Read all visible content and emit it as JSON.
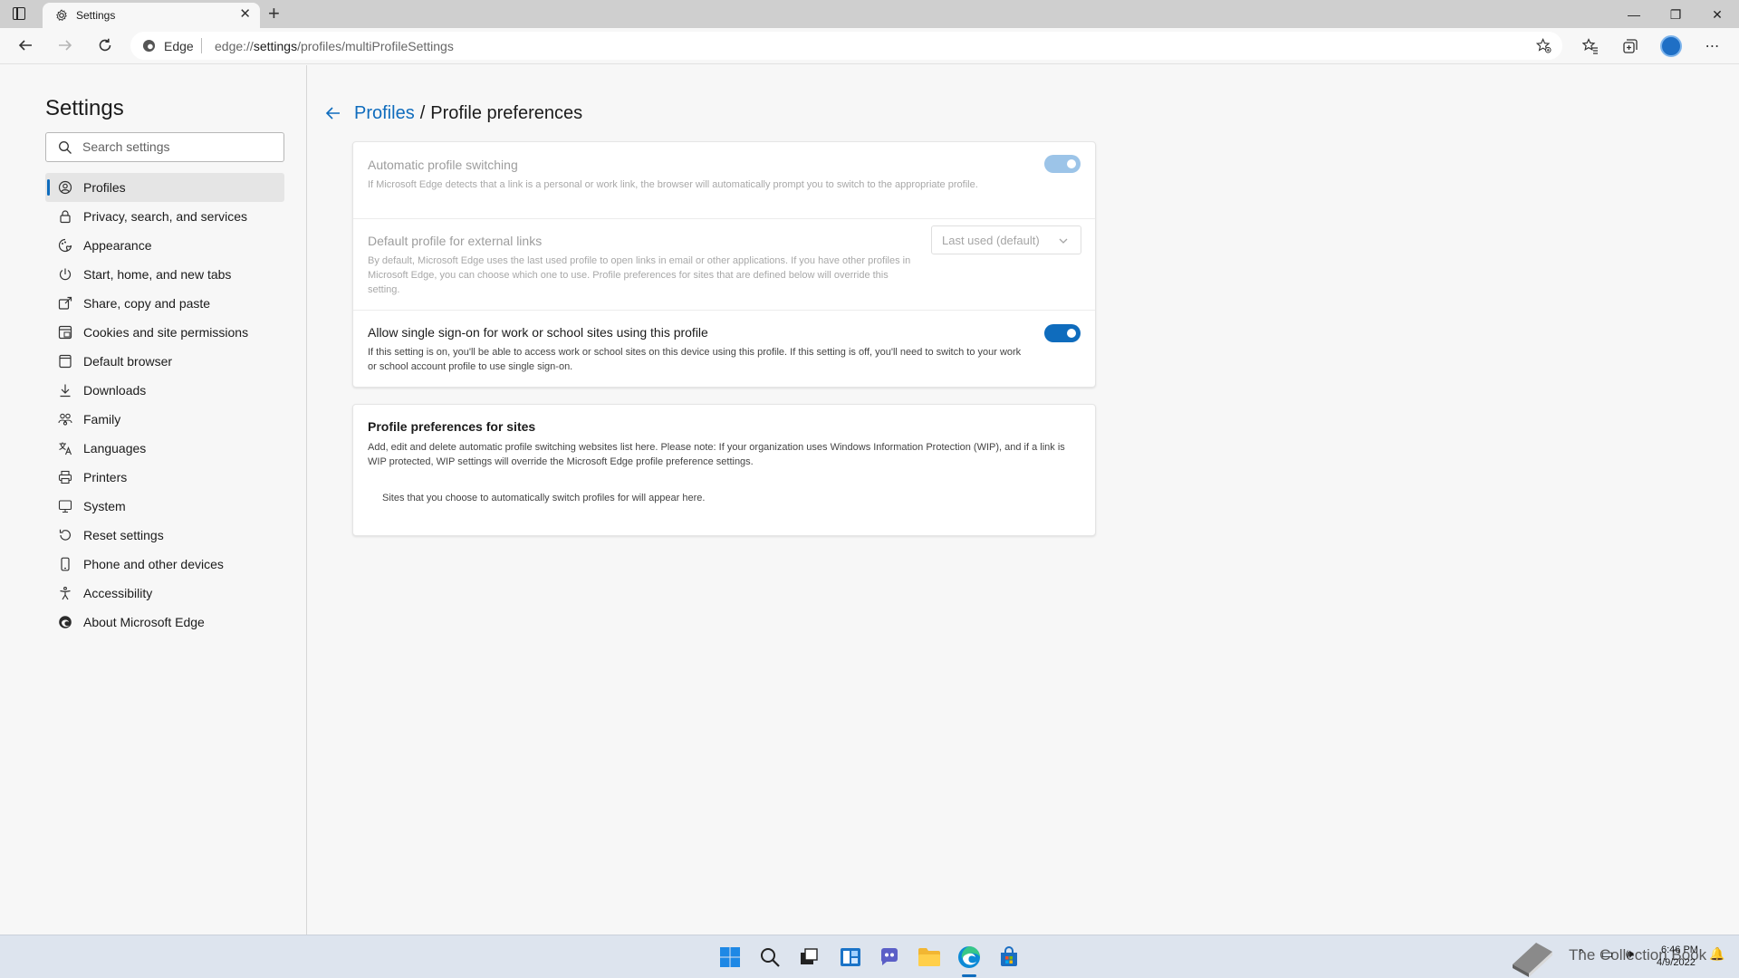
{
  "browser": {
    "tab_title": "Settings",
    "address_identity": "Edge",
    "url_prefix": "edge://",
    "url_host": "settings",
    "url_path": "/profiles/multiProfileSettings"
  },
  "sidebar": {
    "title": "Settings",
    "search_placeholder": "Search settings",
    "items": [
      {
        "label": "Profiles",
        "icon": "profile-icon",
        "active": true
      },
      {
        "label": "Privacy, search, and services",
        "icon": "lock-icon"
      },
      {
        "label": "Appearance",
        "icon": "appearance-icon"
      },
      {
        "label": "Start, home, and new tabs",
        "icon": "power-icon"
      },
      {
        "label": "Share, copy and paste",
        "icon": "share-icon"
      },
      {
        "label": "Cookies and site permissions",
        "icon": "cookies-icon"
      },
      {
        "label": "Default browser",
        "icon": "browser-icon"
      },
      {
        "label": "Downloads",
        "icon": "download-icon"
      },
      {
        "label": "Family",
        "icon": "family-icon"
      },
      {
        "label": "Languages",
        "icon": "languages-icon"
      },
      {
        "label": "Printers",
        "icon": "printer-icon"
      },
      {
        "label": "System",
        "icon": "system-icon"
      },
      {
        "label": "Reset settings",
        "icon": "reset-icon"
      },
      {
        "label": "Phone and other devices",
        "icon": "phone-icon"
      },
      {
        "label": "Accessibility",
        "icon": "accessibility-icon"
      },
      {
        "label": "About Microsoft Edge",
        "icon": "edge-icon"
      }
    ]
  },
  "main": {
    "breadcrumb_link": "Profiles",
    "breadcrumb_sep": "/",
    "breadcrumb_current": "Profile preferences",
    "auto_switch": {
      "title": "Automatic profile switching",
      "desc": "If Microsoft Edge detects that a link is a personal or work link, the browser will automatically prompt you to switch to the appropriate profile.",
      "enabled": true,
      "disabled_ui": true
    },
    "default_profile": {
      "title": "Default profile for external links",
      "desc": "By default, Microsoft Edge uses the last used profile to open links in email or other applications. If you have other profiles in Microsoft Edge, you can choose which one to use. Profile preferences for sites that are defined below will override this setting.",
      "select_value": "Last used (default)"
    },
    "sso": {
      "title": "Allow single sign-on for work or school sites using this profile",
      "desc": "If this setting is on, you'll be able to access work or school sites on this device using this profile. If this setting is off, you'll need to switch to your work or school account profile to use single sign-on.",
      "enabled": true
    },
    "site_prefs": {
      "title": "Profile preferences for sites",
      "desc": "Add, edit and delete automatic profile switching websites list here. Please note: If your organization uses Windows Information Protection (WIP), and if a link is WIP protected, WIP settings will override the Microsoft Edge profile preference settings.",
      "empty_text": "Sites that you choose to automatically switch profiles for will appear here."
    }
  },
  "taskbar": {
    "time": "6:46 PM",
    "date": "4/9/2022",
    "watermark": "The Collection Book"
  },
  "colors": {
    "accent": "#0f6cbd",
    "accent_disabled": "#9cc4e8",
    "taskbar_bg": "#dde4ee"
  }
}
